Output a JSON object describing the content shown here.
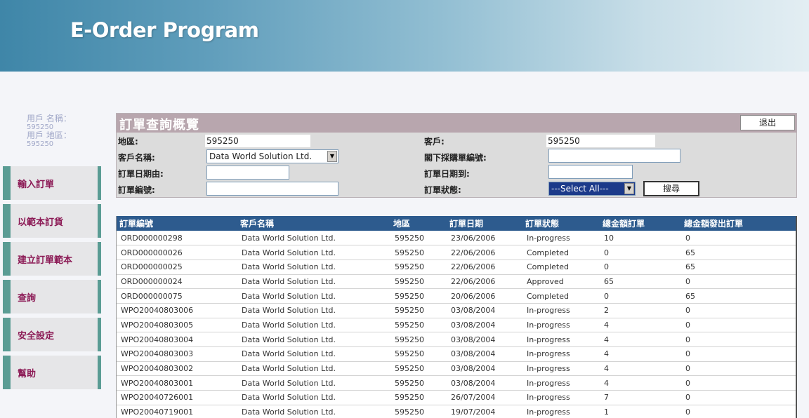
{
  "app": {
    "title": "E-Order Program"
  },
  "user": {
    "name_label": "用戶 名稱：",
    "name_value": "595250",
    "region_label": "用戶 地區：",
    "region_value": "595250"
  },
  "nav": {
    "items": [
      {
        "label": "輸入訂單"
      },
      {
        "label": "以範本訂貨"
      },
      {
        "label": "建立訂單範本"
      },
      {
        "label": "查詢"
      },
      {
        "label": "安全設定"
      },
      {
        "label": "幫助"
      }
    ]
  },
  "search": {
    "title": "訂單查詢概覽",
    "logout_label": "退出",
    "region_label": "地區:",
    "region_value": "595250",
    "customer_label": "客戶:",
    "customer_value": "595250",
    "customer_name_label": "客戶名稱:",
    "customer_name_value": "Data World Solution Ltd.",
    "po_label": "閣下採購單編號:",
    "po_value": "",
    "date_from_label": "訂單日期由:",
    "date_from_value": "",
    "date_to_label": "訂單日期到:",
    "date_to_value": "",
    "order_no_label": "訂單編號:",
    "order_no_value": "",
    "status_label": "訂單狀態:",
    "status_value": "---Select All---",
    "search_label": "搜尋"
  },
  "table": {
    "headers": [
      "訂單編號",
      "客戶名稱",
      "地區",
      "訂單日期",
      "訂單狀態",
      "總金額訂單",
      "總金額發出訂單"
    ],
    "rows": [
      [
        "ORD000000298",
        "Data World Solution Ltd.",
        "595250",
        "23/06/2006",
        "In-progress",
        "10",
        "0"
      ],
      [
        "ORD000000026",
        "Data World Solution Ltd.",
        "595250",
        "22/06/2006",
        "Completed",
        "0",
        "65"
      ],
      [
        "ORD000000025",
        "Data World Solution Ltd.",
        "595250",
        "22/06/2006",
        "Completed",
        "0",
        "65"
      ],
      [
        "ORD000000024",
        "Data World Solution Ltd.",
        "595250",
        "22/06/2006",
        "Approved",
        "65",
        "0"
      ],
      [
        "ORD000000075",
        "Data World Solution Ltd.",
        "595250",
        "20/06/2006",
        "Completed",
        "0",
        "65"
      ],
      [
        "WPO20040803006",
        "Data World Solution Ltd.",
        "595250",
        "03/08/2004",
        "In-progress",
        "2",
        "0"
      ],
      [
        "WPO20040803005",
        "Data World Solution Ltd.",
        "595250",
        "03/08/2004",
        "In-progress",
        "4",
        "0"
      ],
      [
        "WPO20040803004",
        "Data World Solution Ltd.",
        "595250",
        "03/08/2004",
        "In-progress",
        "4",
        "0"
      ],
      [
        "WPO20040803003",
        "Data World Solution Ltd.",
        "595250",
        "03/08/2004",
        "In-progress",
        "4",
        "0"
      ],
      [
        "WPO20040803002",
        "Data World Solution Ltd.",
        "595250",
        "03/08/2004",
        "In-progress",
        "4",
        "0"
      ],
      [
        "WPO20040803001",
        "Data World Solution Ltd.",
        "595250",
        "03/08/2004",
        "In-progress",
        "4",
        "0"
      ],
      [
        "WPO20040726001",
        "Data World Solution Ltd.",
        "595250",
        "26/07/2004",
        "In-progress",
        "7",
        "0"
      ],
      [
        "WPO20040719001",
        "Data World Solution Ltd.",
        "595250",
        "19/07/2004",
        "In-progress",
        "1",
        "0"
      ]
    ]
  }
}
